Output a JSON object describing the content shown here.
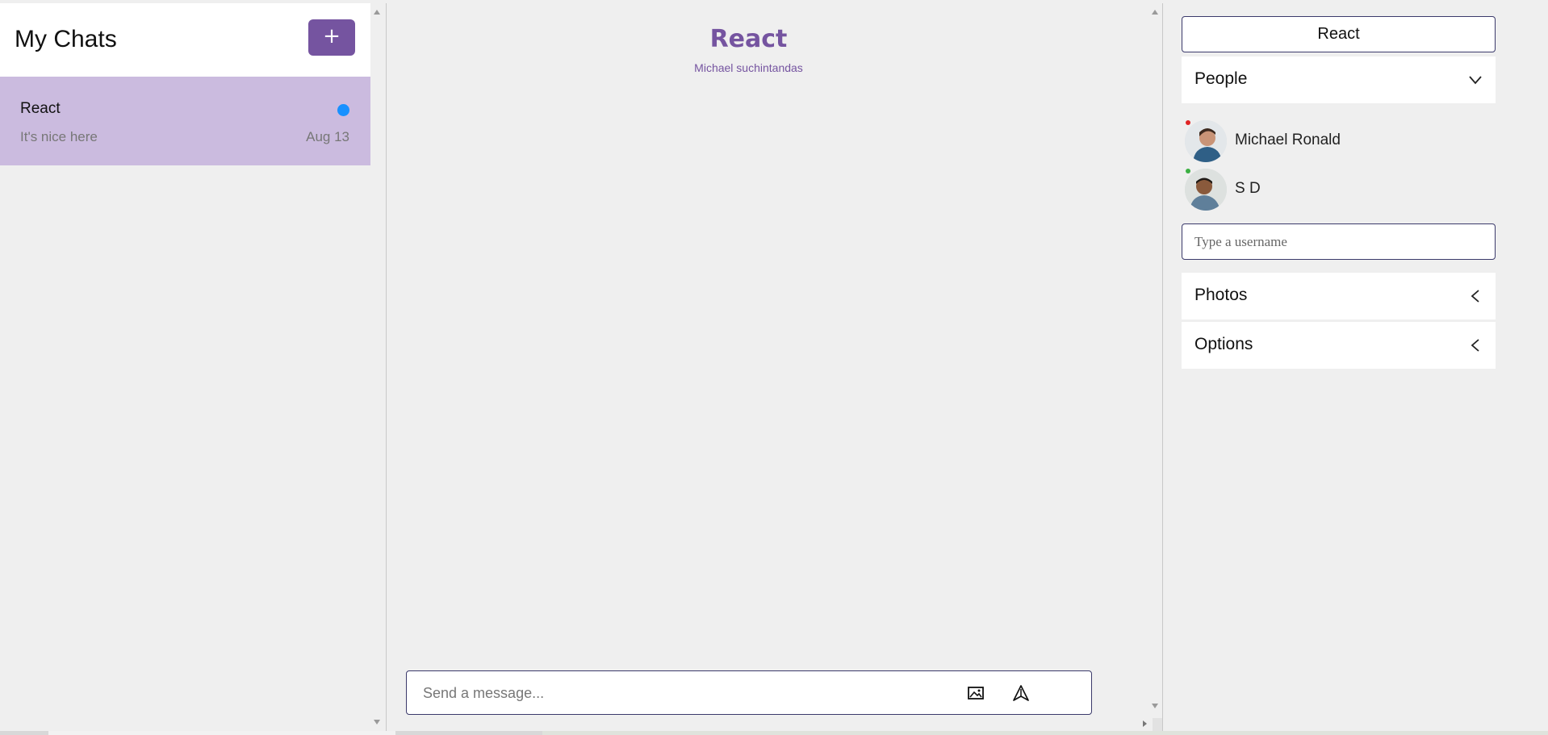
{
  "chat_list": {
    "title": "My Chats",
    "new_chat_label": "+",
    "chats": [
      {
        "title": "React",
        "preview": "It's nice here",
        "date": "Aug 13",
        "unread": true,
        "active": true
      }
    ]
  },
  "feed": {
    "title": "React",
    "subtitle": "Michael suchintandas",
    "message_placeholder": "Send a message...",
    "image_icon": "image-icon",
    "send_icon": "send-icon"
  },
  "settings": {
    "title": "React",
    "people_label": "People",
    "people": [
      {
        "name": "Michael Ronald",
        "status_color": "#e02424"
      },
      {
        "name": "S D",
        "status_color": "#3cb043"
      }
    ],
    "username_placeholder": "Type a username",
    "photos_label": "Photos",
    "options_label": "Options"
  },
  "colors": {
    "accent": "#7554a0",
    "active_chat": "#cbbbdf",
    "unread_dot": "#1890ff"
  }
}
